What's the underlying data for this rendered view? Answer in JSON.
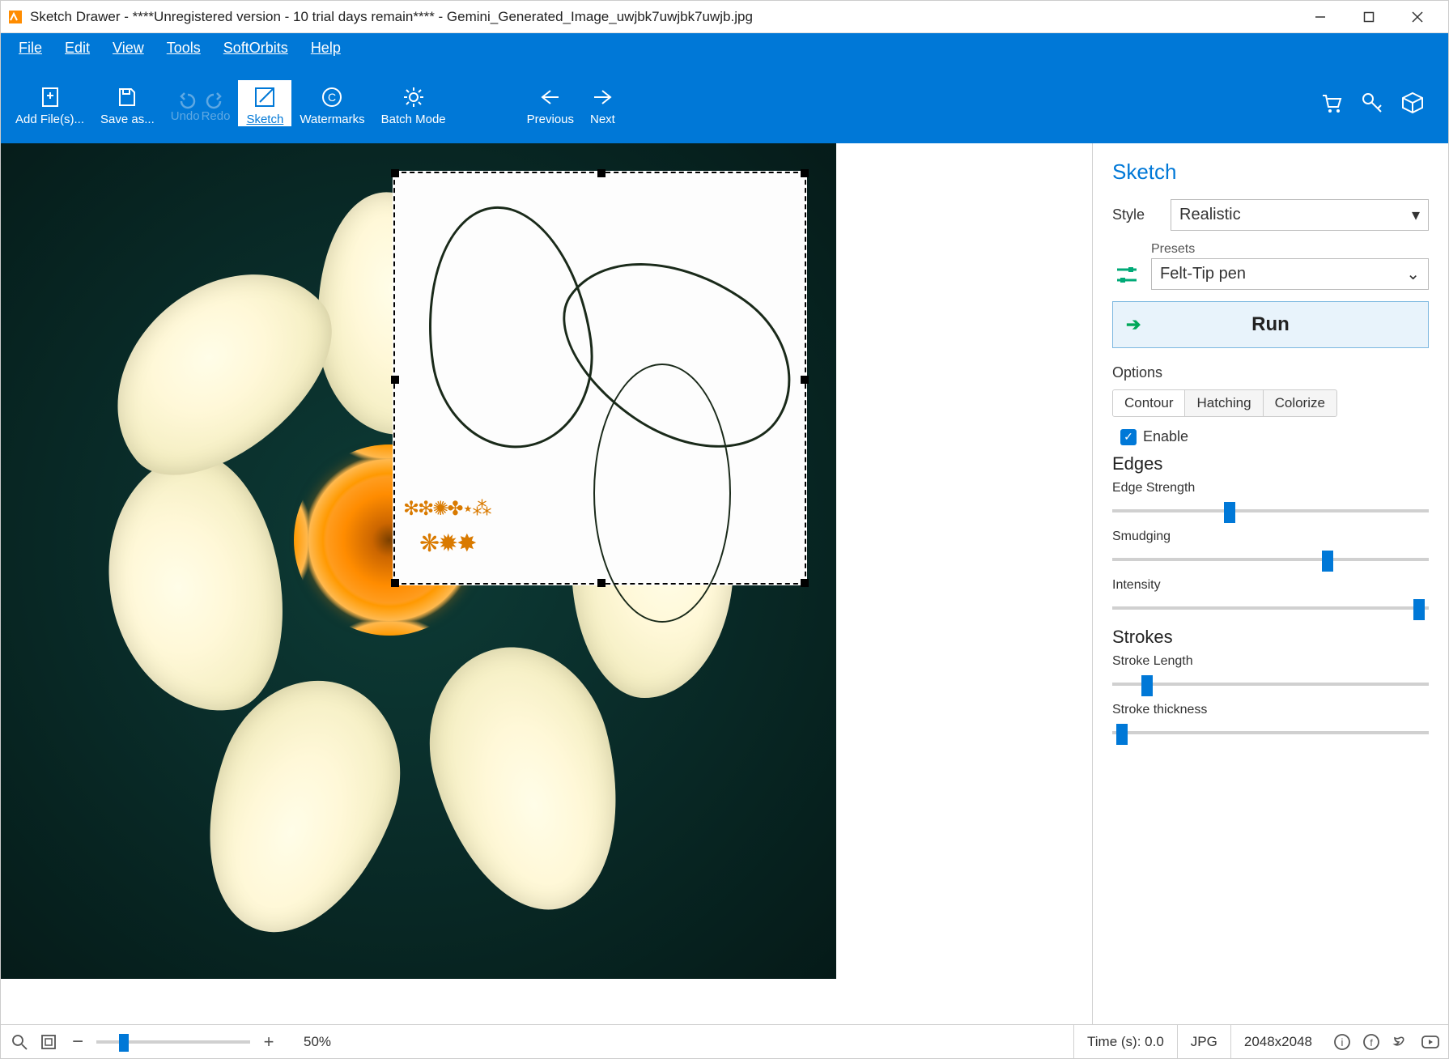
{
  "window": {
    "title": "Sketch Drawer - ****Unregistered version - 10 trial days remain**** - Gemini_Generated_Image_uwjbk7uwjbk7uwjb.jpg"
  },
  "menu": {
    "file": "File",
    "edit": "Edit",
    "view": "View",
    "tools": "Tools",
    "softorbits": "SoftOrbits",
    "help": "Help"
  },
  "ribbon": {
    "add_files": "Add File(s)...",
    "save_as": "Save as...",
    "undo": "Undo",
    "redo": "Redo",
    "sketch": "Sketch",
    "watermarks": "Watermarks",
    "copyright": "©",
    "batch_mode": "Batch Mode",
    "previous": "Previous",
    "next": "Next"
  },
  "panel": {
    "heading": "Sketch",
    "style_label": "Style",
    "style_value": "Realistic",
    "presets_label": "Presets",
    "presets_value": "Felt-Tip pen",
    "run": "Run",
    "options": "Options",
    "tabs": {
      "contour": "Contour",
      "hatching": "Hatching",
      "colorize": "Colorize"
    },
    "enable": "Enable",
    "edges_heading": "Edges",
    "edge_strength": "Edge Strength",
    "smudging": "Smudging",
    "intensity": "Intensity",
    "strokes_heading": "Strokes",
    "stroke_length": "Stroke Length",
    "stroke_thickness": "Stroke thickness",
    "slider_values": {
      "edge_strength_pct": 37,
      "smudging_pct": 68,
      "intensity_pct": 97,
      "stroke_length_pct": 11,
      "stroke_thickness_pct": 3
    }
  },
  "status": {
    "zoom": "50%",
    "zoom_pct": 18,
    "time": "Time (s): 0.0",
    "format": "JPG",
    "dimensions": "2048x2048"
  }
}
